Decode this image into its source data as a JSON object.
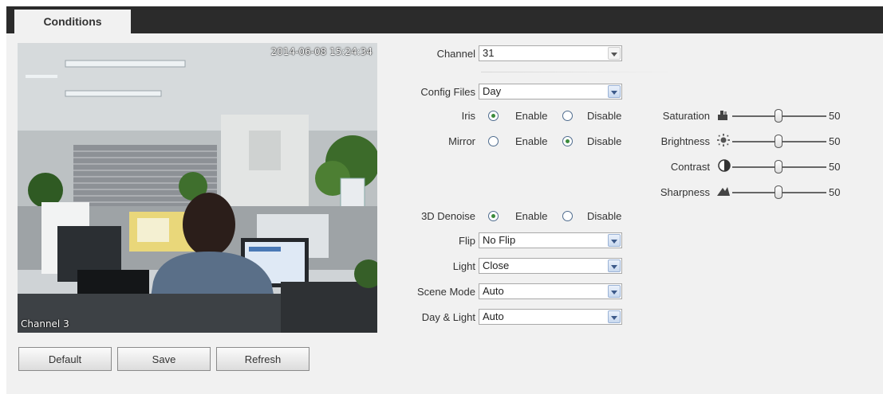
{
  "tab": {
    "label": "Conditions"
  },
  "video": {
    "timestamp": "2014-06-08 15:24:34",
    "channel_label": "Channel 3"
  },
  "channel": {
    "label": "Channel",
    "value": "31"
  },
  "config_files": {
    "label": "Config Files",
    "value": "Day"
  },
  "iris": {
    "label": "Iris",
    "enable": "Enable",
    "disable": "Disable",
    "selected": "Enable"
  },
  "mirror": {
    "label": "Mirror",
    "enable": "Enable",
    "disable": "Disable",
    "selected": "Disable"
  },
  "denoise": {
    "label": "3D Denoise",
    "enable": "Enable",
    "disable": "Disable",
    "selected": "Enable"
  },
  "flip": {
    "label": "Flip",
    "value": "No Flip"
  },
  "light": {
    "label": "Light",
    "value": "Close"
  },
  "scene_mode": {
    "label": "Scene Mode",
    "value": "Auto"
  },
  "day_light": {
    "label": "Day & Light",
    "value": "Auto"
  },
  "sliders": [
    {
      "label": "Saturation",
      "value": "50",
      "icon": "saturation-icon"
    },
    {
      "label": "Brightness",
      "value": "50",
      "icon": "brightness-icon"
    },
    {
      "label": "Contrast",
      "value": "50",
      "icon": "contrast-icon"
    },
    {
      "label": "Sharpness",
      "value": "50",
      "icon": "sharpness-icon"
    }
  ],
  "buttons": {
    "default": "Default",
    "save": "Save",
    "refresh": "Refresh"
  }
}
